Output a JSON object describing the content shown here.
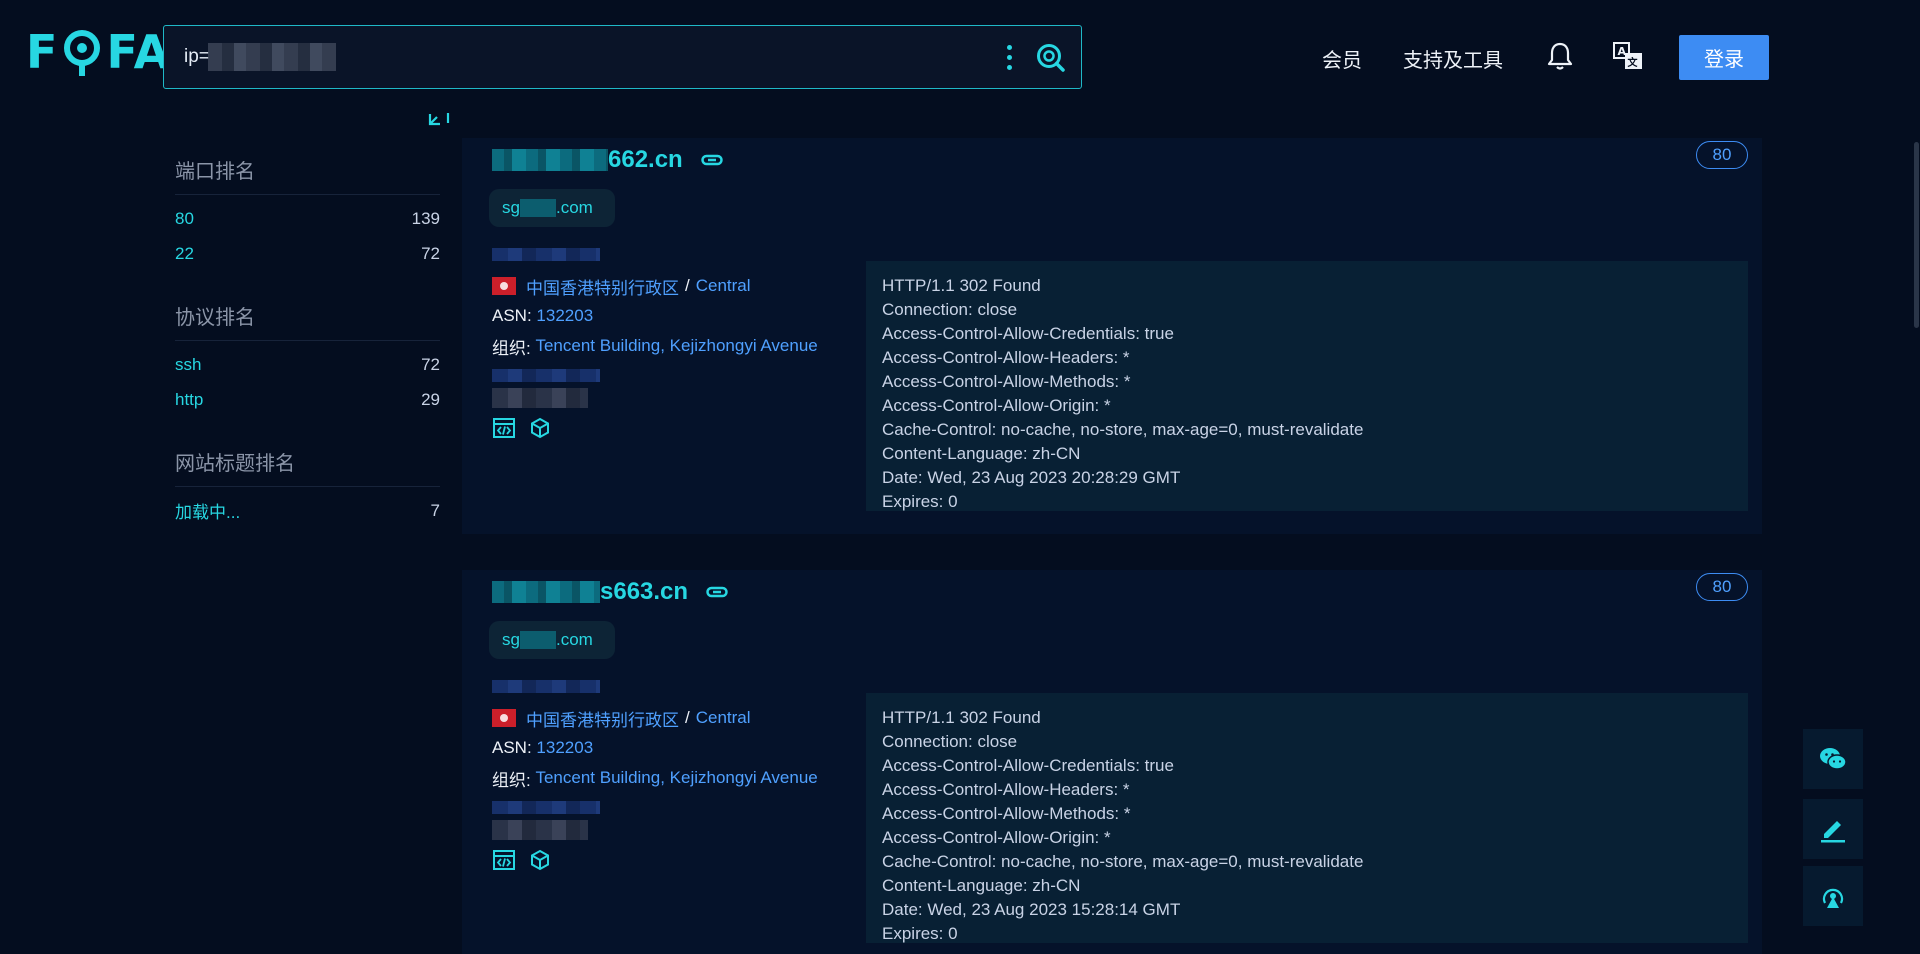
{
  "logo": {
    "text_left": "F",
    "text_right": "FA"
  },
  "search": {
    "value": "ip=",
    "value_suffix": "'"
  },
  "nav": {
    "membership": "会员",
    "support_tools": "支持及工具",
    "login": "登录"
  },
  "sidebar": {
    "groups": [
      {
        "title": "端口排名",
        "items": [
          {
            "key": "80",
            "count": "139"
          },
          {
            "key": "22",
            "count": "72"
          }
        ]
      },
      {
        "title": "协议排名",
        "items": [
          {
            "key": "ssh",
            "count": "72"
          },
          {
            "key": "http",
            "count": "29"
          }
        ]
      },
      {
        "title": "网站标题排名",
        "items": [
          {
            "key": "加载中...",
            "count": "7"
          }
        ]
      }
    ]
  },
  "results": [
    {
      "host_suffix": "662.cn",
      "port": "80",
      "domain_prefix": "sg",
      "domain_suffix": ".com",
      "location_country": "中国香港特别行政区",
      "location_sep": "/",
      "location_city": "Central",
      "asn_label": "ASN:",
      "asn": "132203",
      "org_label": "组织:",
      "org": "Tencent Building, Kejizhongyi Avenue",
      "banner": "HTTP/1.1 302 Found\nConnection: close\nAccess-Control-Allow-Credentials: true\nAccess-Control-Allow-Headers: *\nAccess-Control-Allow-Methods: *\nAccess-Control-Allow-Origin: *\nCache-Control: no-cache, no-store, max-age=0, must-revalidate\nContent-Language: zh-CN\nDate: Wed, 23 Aug 2023 20:28:29 GMT\nExpires: 0"
    },
    {
      "host_suffix": "s663.cn",
      "port": "80",
      "domain_prefix": "sg",
      "domain_suffix": ".com",
      "location_country": "中国香港特别行政区",
      "location_sep": "/",
      "location_city": "Central",
      "asn_label": "ASN:",
      "asn": "132203",
      "org_label": "组织:",
      "org": "Tencent Building, Kejizhongyi Avenue",
      "banner": "HTTP/1.1 302 Found\nConnection: close\nAccess-Control-Allow-Credentials: true\nAccess-Control-Allow-Headers: *\nAccess-Control-Allow-Methods: *\nAccess-Control-Allow-Origin: *\nCache-Control: no-cache, no-store, max-age=0, must-revalidate\nContent-Language: zh-CN\nDate: Wed, 23 Aug 2023 15:28:14 GMT\nExpires: 0"
    }
  ],
  "colors": {
    "accent": "#27d7e2",
    "link": "#4fa0ff",
    "button": "#3d8cf3",
    "background": "#040d1f"
  },
  "icons": [
    "search-icon",
    "more-icon",
    "bell-icon",
    "translate-icon",
    "link-icon",
    "code-icon",
    "cube-icon",
    "wechat-icon",
    "edit-icon",
    "radar-icon",
    "collapse-icon"
  ]
}
